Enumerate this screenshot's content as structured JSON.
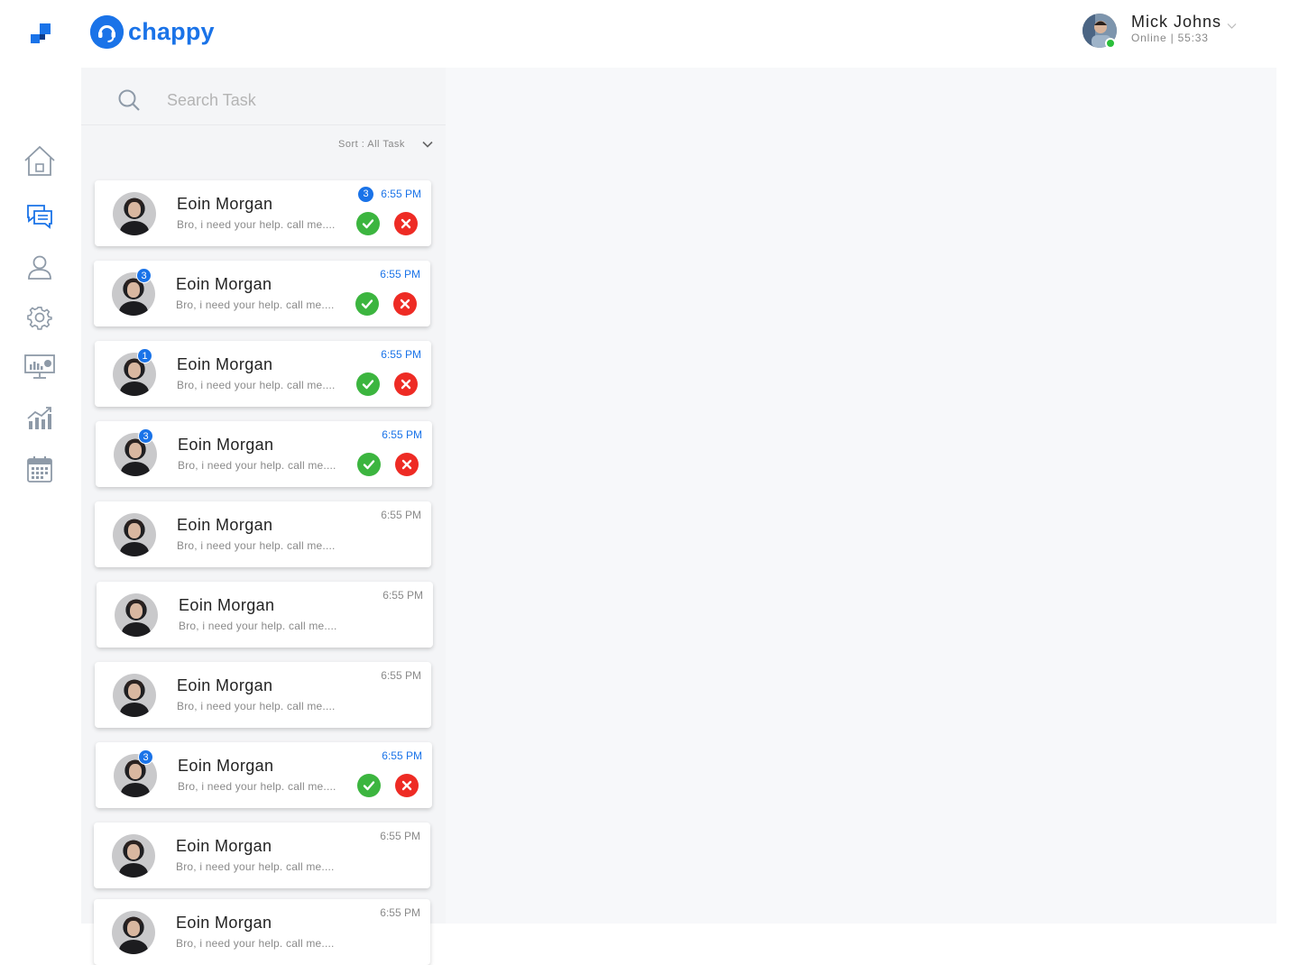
{
  "app": {
    "brand_name": "chappy",
    "brand_color": "#1a73e8"
  },
  "user": {
    "name": "Mick Johns",
    "status": "Online | 55:33",
    "online_color": "#2bbf3a"
  },
  "nav": [
    {
      "icon": "home-icon",
      "active": false
    },
    {
      "icon": "chat-icon",
      "active": true
    },
    {
      "icon": "user-icon",
      "active": false
    },
    {
      "icon": "gear-icon",
      "active": false
    },
    {
      "icon": "monitor-chart-icon",
      "active": false
    },
    {
      "icon": "analytics-icon",
      "active": false
    },
    {
      "icon": "calendar-icon",
      "active": false
    }
  ],
  "search": {
    "placeholder": "Search Task",
    "value": ""
  },
  "sort": {
    "label": "Sort : All Task"
  },
  "tasks": [
    {
      "name": "Eoin Morgan",
      "preview": "Bro, i need your help. call me....",
      "time": "6:55 PM",
      "unread": true,
      "badge": "3",
      "badge_position": "time",
      "actions": true
    },
    {
      "name": "Eoin Morgan",
      "preview": "Bro, i need your help. call me....",
      "time": "6:55 PM",
      "unread": true,
      "badge": "3",
      "badge_position": "avatar",
      "actions": true
    },
    {
      "name": "Eoin Morgan",
      "preview": "Bro, i need your help. call me....",
      "time": "6:55 PM",
      "unread": true,
      "badge": "1",
      "badge_position": "avatar",
      "actions": true
    },
    {
      "name": "Eoin Morgan",
      "preview": "Bro, i need your help. call me....",
      "time": "6:55 PM",
      "unread": true,
      "badge": "3",
      "badge_position": "avatar",
      "actions": true
    },
    {
      "name": "Eoin Morgan",
      "preview": "Bro, i need your help. call me....",
      "time": "6:55 PM",
      "unread": false,
      "badge": "",
      "badge_position": "",
      "actions": false
    },
    {
      "name": "Eoin Morgan",
      "preview": "Bro, i need your help. call me....",
      "time": "6:55 PM",
      "unread": false,
      "badge": "",
      "badge_position": "",
      "actions": false
    },
    {
      "name": "Eoin Morgan",
      "preview": "Bro, i need your help. call me....",
      "time": "6:55 PM",
      "unread": false,
      "badge": "",
      "badge_position": "",
      "actions": false
    },
    {
      "name": "Eoin Morgan",
      "preview": "Bro, i need your help. call me....",
      "time": "6:55 PM",
      "unread": true,
      "badge": "3",
      "badge_position": "avatar",
      "actions": true
    },
    {
      "name": "Eoin Morgan",
      "preview": "Bro, i need your help. call me....",
      "time": "6:55 PM",
      "unread": false,
      "badge": "",
      "badge_position": "",
      "actions": false
    },
    {
      "name": "Eoin Morgan",
      "preview": "Bro, i need your help. call me....",
      "time": "6:55 PM",
      "unread": false,
      "badge": "",
      "badge_position": "",
      "actions": false
    }
  ],
  "colors": {
    "accept": "#3cb53f",
    "reject": "#ee2b24",
    "panel_bg": "#f4f5f7",
    "main_bg": "#f7f8fa"
  }
}
